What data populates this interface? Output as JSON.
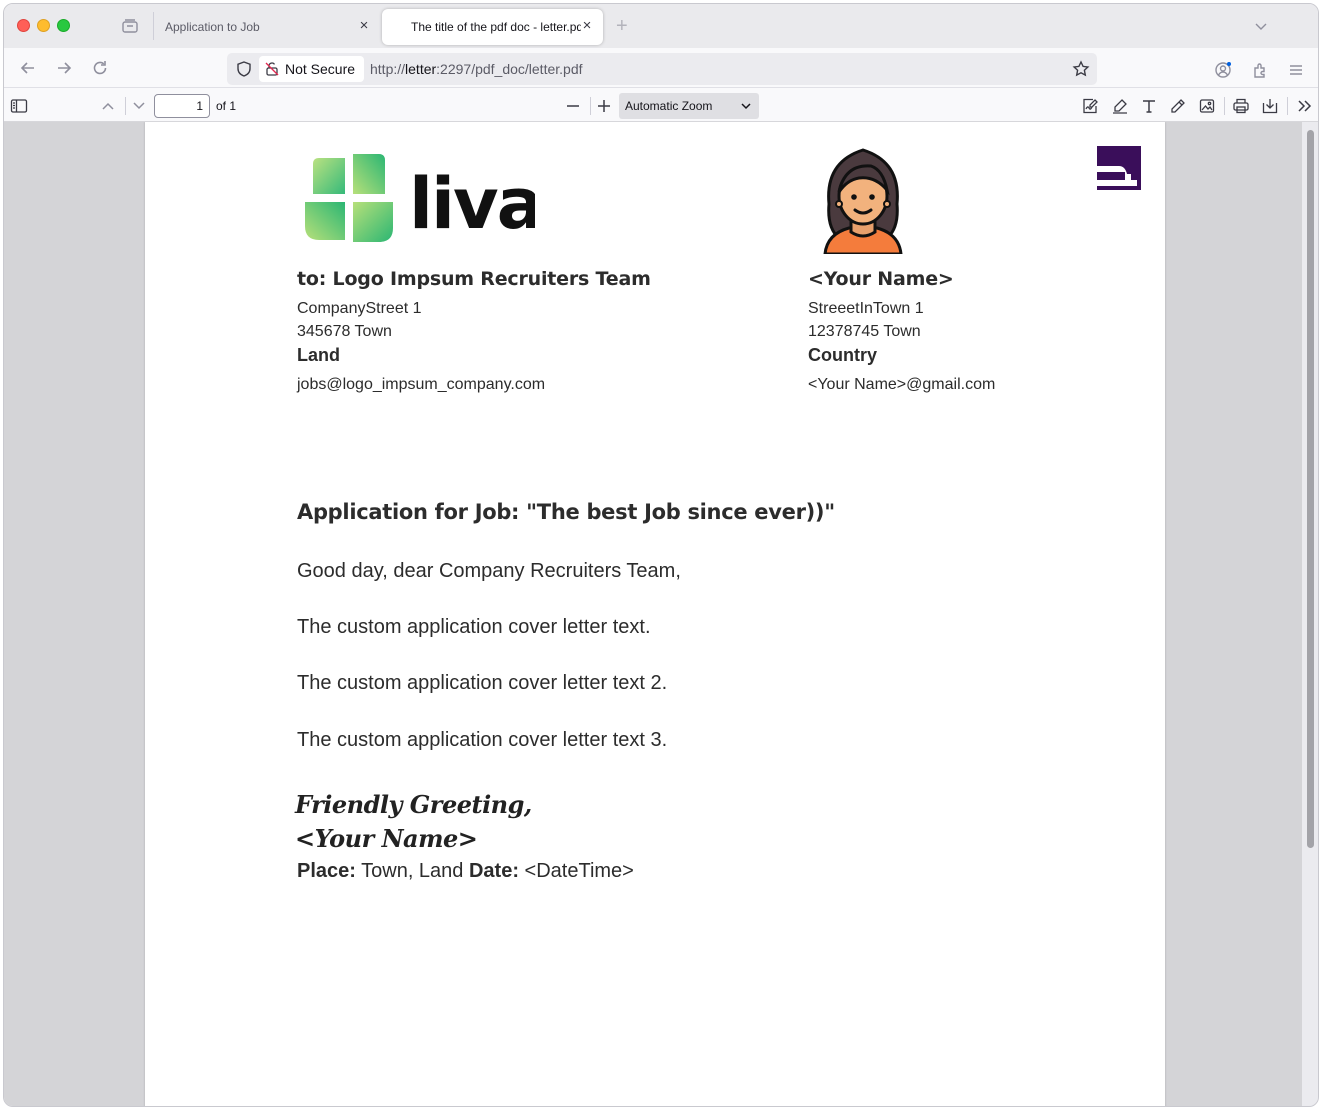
{
  "browser": {
    "tabs": [
      {
        "title": "Application to Job",
        "close": "×"
      },
      {
        "title": "The title of the pdf doc - letter.pdf",
        "close": "×"
      }
    ],
    "new_tab": "+",
    "url_security": "Not Secure",
    "url_prefix": "http://",
    "url_host": "letter",
    "url_rest": ":2297/pdf_doc/letter.pdf"
  },
  "pdf_toolbar": {
    "page_number": "1",
    "page_of": "of 1",
    "zoom": "Automatic Zoom"
  },
  "letter": {
    "recipient": {
      "heading": "to: Logo Impsum Recruiters Team",
      "street": "CompanyStreet 1",
      "city": "345678  Town",
      "country": "Land",
      "email": "jobs@logo_impsum_company.com"
    },
    "sender": {
      "heading": "<Your Name>",
      "street": "StreeetInTown 1",
      "city": "12378745  Town",
      "country": "Country",
      "email": "<Your Name>@gmail.com"
    },
    "logo_text": "liva",
    "subject": "Application for Job: \"The best Job since ever))\"",
    "greeting": "Good day, dear Company Recruiters Team,",
    "paragraphs": [
      "The custom application cover letter text.",
      "The custom application cover letter text 2.",
      "The custom application cover letter text 3."
    ],
    "closing": "Friendly Greeting,",
    "signature": "<Your Name>",
    "place_label": "Place:",
    "place_value": " Town, Land ",
    "date_label": "Date:",
    "date_value": " <DateTime>"
  },
  "colors": {
    "logo_green_light": "#b7e07a",
    "logo_green_dark": "#2bb673",
    "corner_mark": "#3a0e5a",
    "avatar_shirt": "#f47c3c"
  }
}
